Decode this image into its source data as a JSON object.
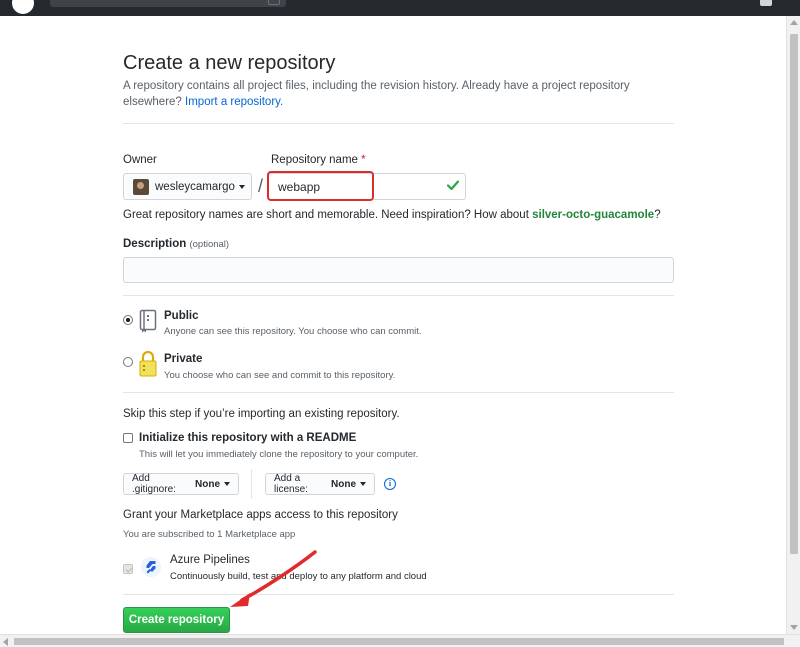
{
  "page": {
    "title": "Create a new repository",
    "subtitle": "A repository contains all project files, including the revision history. Already have a project repository elsewhere?",
    "import_link": "Import a repository."
  },
  "owner": {
    "label": "Owner",
    "value": "wesleycamargo"
  },
  "repo_name": {
    "label": "Repository name",
    "required_mark": "*",
    "value": "webapp"
  },
  "hint": {
    "text": "Great repository names are short and memorable. Need inspiration? How about",
    "suggestion": "silver-octo-guacamole",
    "end": "?"
  },
  "description": {
    "label": "Description",
    "optional": "(optional)",
    "value": ""
  },
  "visibility": {
    "public_title": "Public",
    "public_desc": "Anyone can see this repository. You choose who can commit.",
    "private_title": "Private",
    "private_desc": "You choose who can see and commit to this repository.",
    "selected": "public"
  },
  "init": {
    "skip_text": "Skip this step if you’re importing an existing repository.",
    "readme_label": "Initialize this repository with a README",
    "readme_desc": "This will let you immediately clone the repository to your computer.",
    "gitignore_label": "Add .gitignore:",
    "gitignore_value": "None",
    "license_label": "Add a license:",
    "license_value": "None"
  },
  "marketplace": {
    "heading": "Grant your Marketplace apps access to this repository",
    "subscribed": "You are subscribed to 1 Marketplace app",
    "app_name": "Azure Pipelines",
    "app_desc": "Continuously build, test and deploy to any platform and cloud"
  },
  "actions": {
    "create_label": "Create repository"
  },
  "colors": {
    "accent_link": "#0366d6",
    "create_button": "#28a745",
    "annotation": "#e02b2b"
  }
}
